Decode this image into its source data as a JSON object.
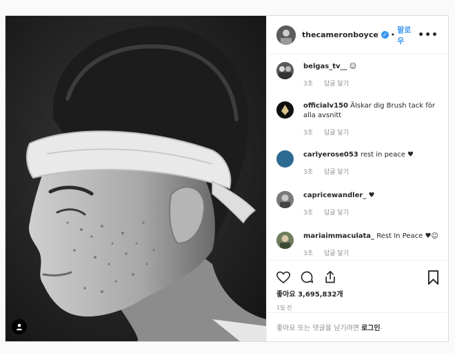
{
  "post": {
    "author": "thecameronboyce",
    "follow_label": "팔로우",
    "separator": "•",
    "more_label": "•••"
  },
  "comments": [
    {
      "user": "belgas_tv__",
      "text": "☺",
      "time": "3초",
      "reply": "답글 달기",
      "avatar_color": "#5a5a5a"
    },
    {
      "user": "officialv150",
      "text": "Älskar dig Brush tack för alla avsnitt",
      "time": "3초",
      "reply": "답글 달기",
      "avatar_color": "#111111"
    },
    {
      "user": "carlyerose053",
      "text": "rest in peace ♥",
      "time": "3초",
      "reply": "답글 달기",
      "avatar_color": "#2d6b93"
    },
    {
      "user": "capricewandler_",
      "text": "♥",
      "time": "3초",
      "reply": "답글 달기",
      "avatar_color": "#7a7a7a"
    },
    {
      "user": "mariaimmaculata_",
      "text": "Rest In Peace ♥☺",
      "time": "3초",
      "reply": "답글 달기",
      "avatar_color": "#6f7d5e"
    }
  ],
  "likes": {
    "label": "좋아요",
    "count": "3,695,832개"
  },
  "posted_ago": "1일 전",
  "login_prompt": {
    "text": "좋아요 또는 댓글을 남기려면",
    "link": "로그인",
    "suffix": "."
  },
  "icons": {
    "like": "heart-icon",
    "comment": "comment-icon",
    "share": "share-icon",
    "save": "bookmark-icon",
    "verified": "verified-badge-icon",
    "tag": "user-tag-icon"
  },
  "colors": {
    "accent": "#3897f0",
    "text": "#262626",
    "muted": "#8e8e8e"
  }
}
